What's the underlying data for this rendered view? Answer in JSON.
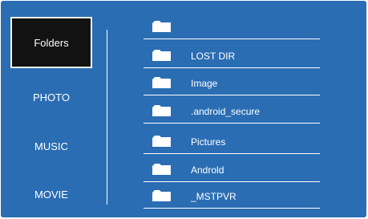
{
  "categories": [
    {
      "label": "Folders",
      "selected": true
    },
    {
      "label": "PHOTO"
    },
    {
      "label": "MUSIC"
    },
    {
      "label": "MOVIE"
    }
  ],
  "folders": [
    {
      "name": "",
      "icon": "folder-icon"
    },
    {
      "name": "LOST DIR",
      "icon": "folder-icon"
    },
    {
      "name": "Image",
      "icon": "folder-icon"
    },
    {
      "name": ".android_secure",
      "icon": "folder-icon"
    },
    {
      "name": "Pictures",
      "icon": "folder-icon"
    },
    {
      "name": "Androld",
      "icon": "folder-icon"
    },
    {
      "name": "_MSTPVR",
      "icon": "folder-icon"
    }
  ],
  "colors": {
    "background": "#2a6db3",
    "selected_background": "#121212",
    "text": "#ffffff"
  }
}
